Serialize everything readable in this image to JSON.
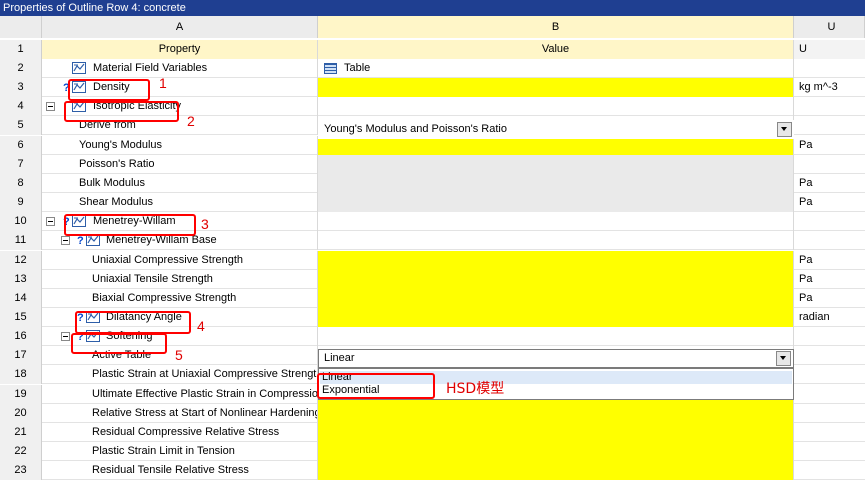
{
  "window": {
    "title": "Properties of Outline Row 4: concrete"
  },
  "columns": {
    "row": "",
    "a": "A",
    "b": "B",
    "c": "U"
  },
  "header_row": {
    "num": "1",
    "property": "Property",
    "value": "Value",
    "unit": "U"
  },
  "rows": [
    {
      "num": "2",
      "label": "Material Field Variables",
      "value": "Table",
      "unit": ""
    },
    {
      "num": "3",
      "label": "Density",
      "value": "",
      "unit": "kg m^-3"
    },
    {
      "num": "4",
      "label": "Isotropic Elasticity",
      "value": "",
      "unit": ""
    },
    {
      "num": "5",
      "label": "Derive from",
      "value": "Young's Modulus and Poisson's Ratio",
      "unit": ""
    },
    {
      "num": "6",
      "label": "Young's Modulus",
      "value": "",
      "unit": "Pa"
    },
    {
      "num": "7",
      "label": "Poisson's Ratio",
      "value": "",
      "unit": ""
    },
    {
      "num": "8",
      "label": "Bulk Modulus",
      "value": "",
      "unit": "Pa"
    },
    {
      "num": "9",
      "label": "Shear Modulus",
      "value": "",
      "unit": "Pa"
    },
    {
      "num": "10",
      "label": "Menetrey-Willam",
      "value": "",
      "unit": ""
    },
    {
      "num": "11",
      "label": "Menetrey-Willam Base",
      "value": "",
      "unit": ""
    },
    {
      "num": "12",
      "label": "Uniaxial Compressive Strength",
      "value": "",
      "unit": "Pa"
    },
    {
      "num": "13",
      "label": "Uniaxial Tensile Strength",
      "value": "",
      "unit": "Pa"
    },
    {
      "num": "14",
      "label": "Biaxial Compressive Strength",
      "value": "",
      "unit": "Pa"
    },
    {
      "num": "15",
      "label": "Dilatancy Angle",
      "value": "",
      "unit": "radian"
    },
    {
      "num": "16",
      "label": "Softening",
      "value": "",
      "unit": ""
    },
    {
      "num": "17",
      "label": "Active Table",
      "value": "Linear",
      "unit": ""
    },
    {
      "num": "18",
      "label": "Plastic Strain at Uniaxial Compressive Strength",
      "value": "",
      "unit": ""
    },
    {
      "num": "19",
      "label": "Ultimate Effective Plastic Strain in Compression",
      "value": "",
      "unit": ""
    },
    {
      "num": "20",
      "label": "Relative Stress at Start of Nonlinear Hardening",
      "value": "",
      "unit": ""
    },
    {
      "num": "21",
      "label": "Residual Compressive Relative Stress",
      "value": "",
      "unit": ""
    },
    {
      "num": "22",
      "label": "Plastic Strain Limit in Tension",
      "value": "",
      "unit": ""
    },
    {
      "num": "23",
      "label": "Residual Tensile Relative Stress",
      "value": "",
      "unit": ""
    }
  ],
  "dropdown_options": [
    "Linear",
    "Exponential"
  ],
  "annotations": {
    "n1": "1",
    "n2": "2",
    "n3": "3",
    "n4": "4",
    "n5": "5",
    "hsd": "HSD模型"
  },
  "colors": {
    "title_bar": "#1f3f91",
    "required_cell": "#ffff00",
    "annotation": "#e00000"
  }
}
